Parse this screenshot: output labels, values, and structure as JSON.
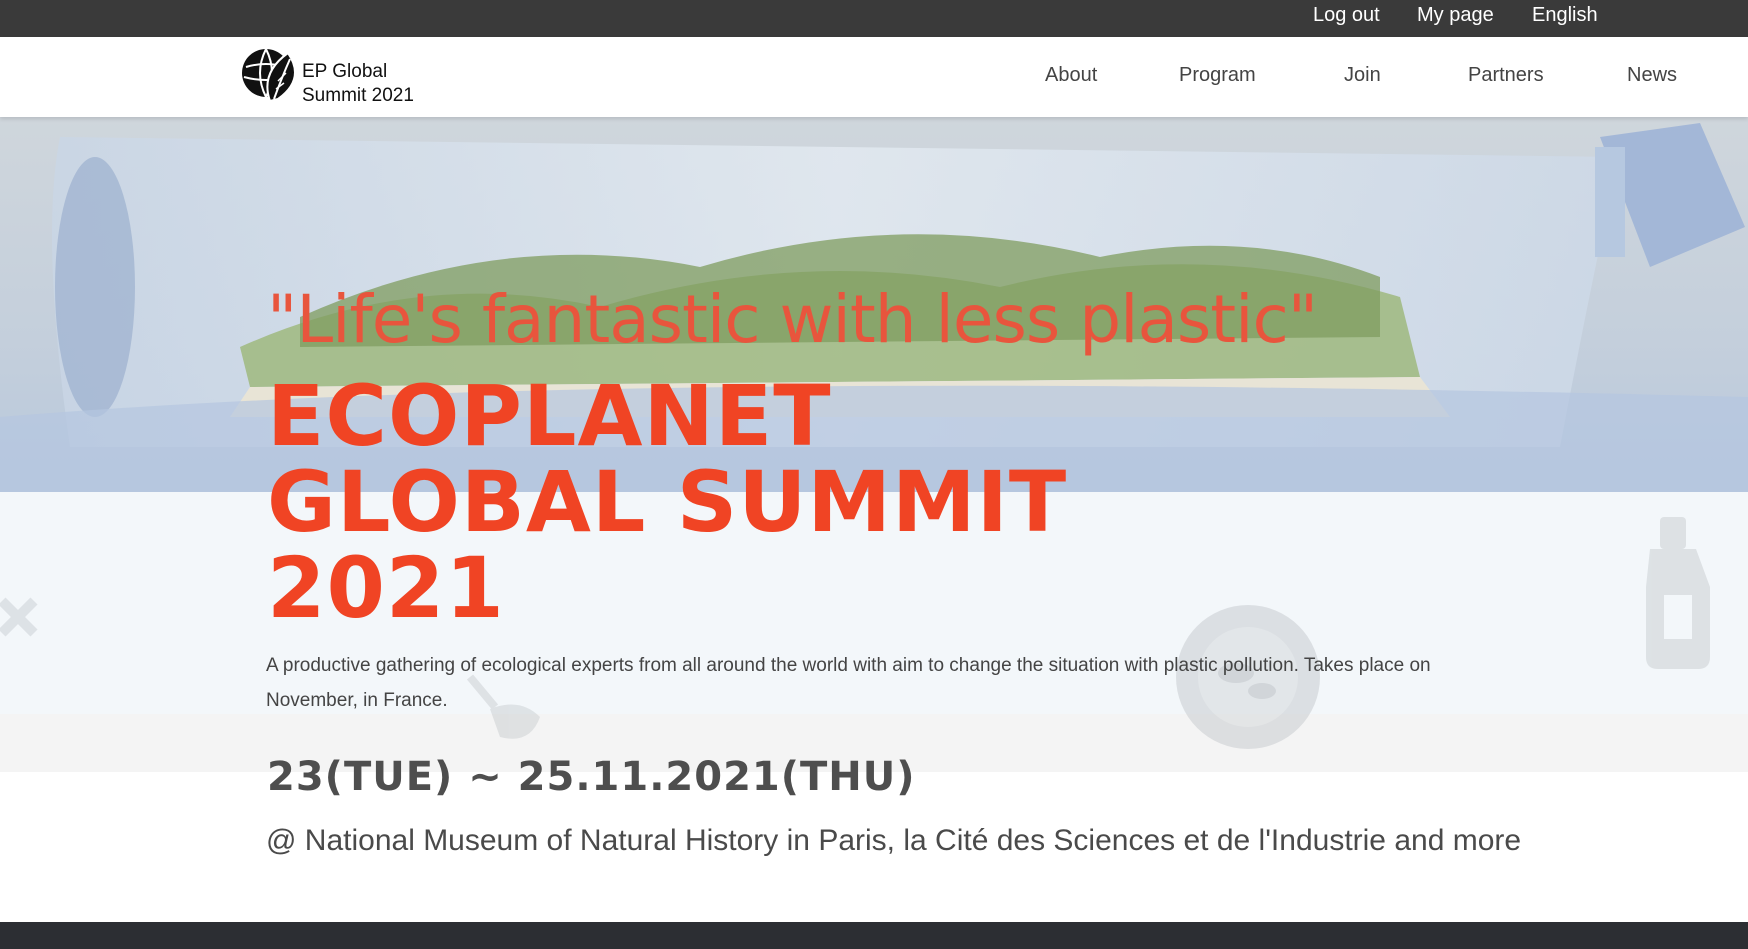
{
  "topbar": {
    "logout_label": "Log out",
    "mypage_label": "My page",
    "language_label": "English"
  },
  "header": {
    "logo_line1": "EP Global",
    "logo_line2": "Summit 2021",
    "nav": [
      "About",
      "Program",
      "Join",
      "Partners",
      "News"
    ]
  },
  "hero": {
    "slogan": "\"Life's fantastic with less plastic\"",
    "title_lines": [
      "ECOPLANET",
      "GLOBAL SUMMIT",
      "2021"
    ],
    "description": "A productive gathering of ecological experts from all around the world with aim to change the situation with plastic pollution. Takes place on November, in France.",
    "dates": "23(TUE) ~ 25.11.2021(THU)",
    "venue": "@ National Museum of Natural History in Paris, la Cité des Sciences et de l'Industrie and more"
  },
  "colors": {
    "topbar_bg": "#3a3a3a",
    "accent_red": "#f04424",
    "slogan_red": "#e8553d",
    "footer_bg": "#2c2e33"
  },
  "icons": [
    "globe-leaf-logo-icon",
    "bottle-island-hero-image",
    "x-mark-icon",
    "bottle-icon",
    "fish-plate-icon",
    "spoon-icon"
  ]
}
